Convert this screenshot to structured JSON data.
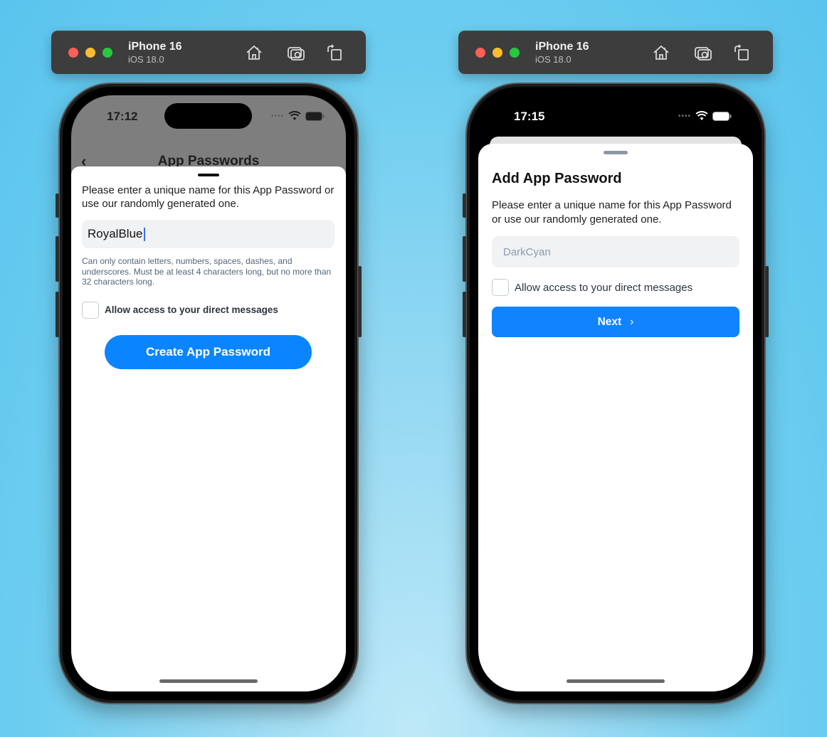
{
  "simulators": [
    {
      "device": "iPhone 16",
      "os": "iOS 18.0",
      "toolbar_icons": [
        "home-icon",
        "screenshot-icon",
        "rotate-icon"
      ],
      "status_time": "17:12",
      "nav": {
        "back_icon": "chevron-left-icon",
        "title": "App Passwords"
      },
      "sheet": {
        "description": "Please enter a unique name for this App Password or use our randomly generated one.",
        "input_value": "RoyalBlue",
        "hint": "Can only contain letters, numbers, spaces, dashes, and underscores. Must be at least 4 characters long, but no more than 32 characters long.",
        "checkbox_label": "Allow access to your direct messages",
        "checkbox_checked": false,
        "button_label": "Create App Password"
      }
    },
    {
      "device": "iPhone 16",
      "os": "iOS 18.0",
      "toolbar_icons": [
        "home-icon",
        "screenshot-icon",
        "rotate-icon"
      ],
      "status_time": "17:15",
      "sheet": {
        "title": "Add App Password",
        "description": "Please enter a unique name for this App Password or use our randomly generated one.",
        "input_placeholder": "DarkCyan",
        "checkbox_label": "Allow access to your direct messages",
        "checkbox_checked": false,
        "button_label": "Next",
        "button_icon": "chevron-right-icon"
      }
    }
  ],
  "colors": {
    "primary_button": "#0a85ff",
    "traffic_red": "#fe5f57",
    "traffic_yellow": "#febc2e",
    "traffic_green": "#28c840"
  }
}
